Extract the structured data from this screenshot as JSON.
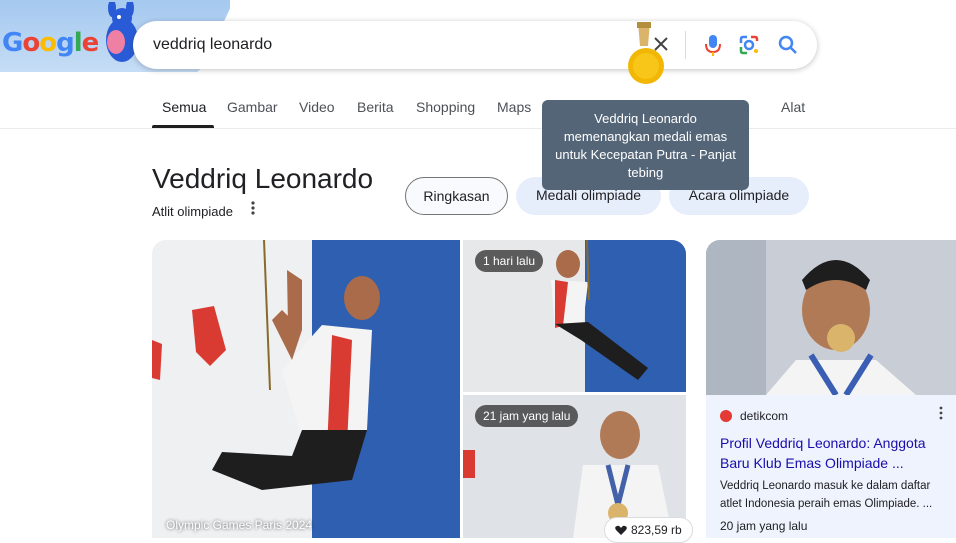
{
  "header": {
    "logo_letters": [
      "G",
      "o",
      "o",
      "g",
      "l",
      "e"
    ],
    "search": {
      "value": "veddriq leonardo",
      "placeholder": ""
    },
    "icons": [
      "close-icon",
      "mic-icon",
      "lens-icon",
      "search-icon"
    ],
    "colors": {
      "blue": "#4285f4",
      "red": "#ea4335",
      "yellow": "#fbbc05",
      "green": "#34a853"
    }
  },
  "tabs": [
    {
      "label": "Semua",
      "active": true
    },
    {
      "label": "Gambar"
    },
    {
      "label": "Video"
    },
    {
      "label": "Berita"
    },
    {
      "label": "Shopping"
    },
    {
      "label": "Maps"
    },
    {
      "label": "Alat"
    }
  ],
  "tooltip": {
    "text": "Veddriq Leonardo memenangkan medali emas untuk Kecepatan Putra - Panjat tebing"
  },
  "entity": {
    "title": "Veddriq Leonardo",
    "subtitle": "Atlit olimpiade",
    "chips": [
      "Ringkasan",
      "Medali olimpiade",
      "Acara olimpiade"
    ]
  },
  "images": {
    "main_caption": "Olympic Games Paris 2024",
    "top_badge": "1 hari lalu",
    "bottom_badge": "21 jam yang lalu",
    "likes": "823,59 rb"
  },
  "news": {
    "source": "detikcom",
    "title": "Profil Veddriq Leonardo: Anggota Baru Klub Emas Olimpiade ...",
    "snippet": "Veddriq Leonardo masuk ke dalam daftar atlet Indonesia peraih emas Olimpiade. ...",
    "time": "20 jam yang lalu"
  }
}
